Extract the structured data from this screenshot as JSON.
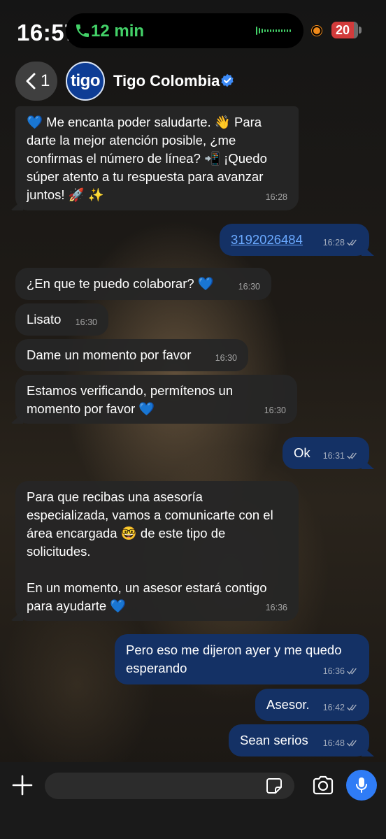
{
  "status_bar": {
    "time": "16:57",
    "call_duration": "12 min",
    "battery": "20",
    "call_color": "#43d168",
    "battery_color": "#d23b3b"
  },
  "header": {
    "back_count": "1",
    "avatar_text": "tigo",
    "contact_name": "Tigo Colombia",
    "verified_icon": "verified-badge-icon"
  },
  "messages": [
    {
      "direction": "in",
      "text": "💙 Me encanta poder saludarte. 👋 Para darte la mejor atención posible, ¿me confirmas el número de línea? 📲 ¡Quedo súper atento a tu respuesta para avanzar juntos! 🚀 ✨",
      "time": "16:28"
    },
    {
      "direction": "out",
      "text": "3192026484",
      "time": "16:28"
    },
    {
      "direction": "in",
      "text": "¿En que te puedo colaborar? 💙",
      "time": "16:30"
    },
    {
      "direction": "in",
      "text": "Lisato",
      "time": "16:30"
    },
    {
      "direction": "in",
      "text": "Dame un momento por favor",
      "time": "16:30"
    },
    {
      "direction": "in",
      "text": "Estamos verificando, permítenos un momento por favor 💙",
      "time": "16:30"
    },
    {
      "direction": "out",
      "text": "Ok",
      "time": "16:31"
    },
    {
      "direction": "in",
      "text": "Para que recibas una asesoría especializada, vamos a comunicarte con el área encargada 🤓 de este tipo de solicitudes.\n\nEn un momento, un asesor estará contigo para ayudarte 💙",
      "time": "16:36"
    },
    {
      "direction": "out",
      "text": "Pero eso me dijeron ayer y me quedo esperando",
      "time": "16:36"
    },
    {
      "direction": "out",
      "text": "Asesor.",
      "time": "16:42"
    },
    {
      "direction": "out",
      "text": "Sean serios",
      "time": "16:48"
    }
  ],
  "input_bar": {
    "placeholder": "",
    "mic_color": "#2f7cf6",
    "icons": [
      "plus-icon",
      "sticker-icon",
      "camera-icon",
      "microphone-icon"
    ]
  }
}
